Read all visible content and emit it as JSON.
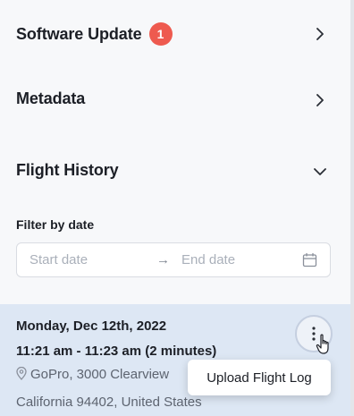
{
  "sections": [
    {
      "title": "Software Update",
      "badge": "1",
      "chevron": "chevron-right-icon"
    },
    {
      "title": "Metadata",
      "chevron": "chevron-right-icon"
    },
    {
      "title": "Flight History",
      "chevron": "chevron-down-icon"
    }
  ],
  "filter": {
    "label": "Filter by date",
    "start_placeholder": "Start date",
    "arrow": "→",
    "end_placeholder": "End date",
    "icon": "calendar-icon"
  },
  "flight": {
    "date": "Monday, Dec 12th, 2022",
    "time": "11:21 am - 11:23 am (2 minutes)",
    "location": "GoPro, 3000 Clearview",
    "address_line2": "California 94402, United States",
    "menu_item": "Upload Flight Log"
  },
  "colors": {
    "badge": "#ee5a4f",
    "card_bg": "#dde7f4"
  }
}
